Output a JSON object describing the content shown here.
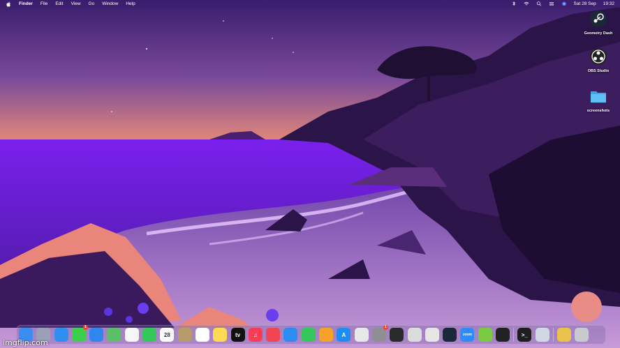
{
  "menubar": {
    "app": "Finder",
    "menus": [
      "File",
      "Edit",
      "View",
      "Go",
      "Window",
      "Help"
    ],
    "date": "Sat 28 Sep",
    "time": "19:32",
    "status_icons": [
      "bluetooth-icon",
      "wifi-icon",
      "search-icon",
      "control-center-icon",
      "siri-icon"
    ]
  },
  "desktop": {
    "icons": [
      {
        "label": "Geometry Dash",
        "icon": "steam-icon"
      },
      {
        "label": "OBS Studio",
        "icon": "obs-icon"
      },
      {
        "label": "screenshots",
        "icon": "folder-icon"
      }
    ]
  },
  "dock": {
    "items": [
      {
        "name": "finder",
        "color": "#3d8cf0",
        "glyph": ""
      },
      {
        "name": "launchpad",
        "color": "#9aa0b8",
        "glyph": ""
      },
      {
        "name": "safari",
        "color": "#2e8ff0",
        "glyph": ""
      },
      {
        "name": "messages",
        "color": "#3ccf4e",
        "glyph": "",
        "badge": "1"
      },
      {
        "name": "mail",
        "color": "#2f86ef",
        "glyph": ""
      },
      {
        "name": "maps",
        "color": "#5bbf6a",
        "glyph": ""
      },
      {
        "name": "photos",
        "color": "#f6f6f6",
        "glyph": ""
      },
      {
        "name": "facetime",
        "color": "#34c759",
        "glyph": ""
      },
      {
        "name": "calendar",
        "color": "#ffffff",
        "glyph": "28"
      },
      {
        "name": "contacts",
        "color": "#b89b6a",
        "glyph": ""
      },
      {
        "name": "reminders",
        "color": "#ffffff",
        "glyph": ""
      },
      {
        "name": "notes",
        "color": "#ffd952",
        "glyph": ""
      },
      {
        "name": "apple-tv",
        "color": "#111111",
        "glyph": "tv"
      },
      {
        "name": "music",
        "color": "#fa3d55",
        "glyph": "♫"
      },
      {
        "name": "news",
        "color": "#f24452",
        "glyph": ""
      },
      {
        "name": "keynote",
        "color": "#2b8cf2",
        "glyph": ""
      },
      {
        "name": "numbers",
        "color": "#35c759",
        "glyph": ""
      },
      {
        "name": "pages",
        "color": "#f7a12a",
        "glyph": ""
      },
      {
        "name": "app-store",
        "color": "#1e8cf5",
        "glyph": "A"
      },
      {
        "name": "chrome",
        "color": "#e8e8e8",
        "glyph": ""
      },
      {
        "name": "system-settings",
        "color": "#8e8e93",
        "glyph": "",
        "badge": "1"
      },
      {
        "name": "imovie-app",
        "color": "#2a2a2a",
        "glyph": ""
      },
      {
        "name": "screenshot",
        "color": "#dcdcdc",
        "glyph": ""
      },
      {
        "name": "roblox",
        "color": "#e6e6e6",
        "glyph": ""
      },
      {
        "name": "steam",
        "color": "#1b2838",
        "glyph": ""
      },
      {
        "name": "zoom",
        "color": "#2d8cff",
        "glyph": "zoom"
      },
      {
        "name": "geometry-dash",
        "color": "#7ac943",
        "glyph": ""
      },
      {
        "name": "obs",
        "color": "#222222",
        "glyph": ""
      },
      {
        "name": "terminal",
        "color": "#1e1e1e",
        "glyph": ">_"
      },
      {
        "name": "preview",
        "color": "#cfd8e3",
        "glyph": ""
      },
      {
        "name": "archive",
        "color": "#e8c24a",
        "glyph": ""
      },
      {
        "name": "trash",
        "color": "#c9c9d0",
        "glyph": ""
      }
    ]
  },
  "watermark": "imgflip.com"
}
